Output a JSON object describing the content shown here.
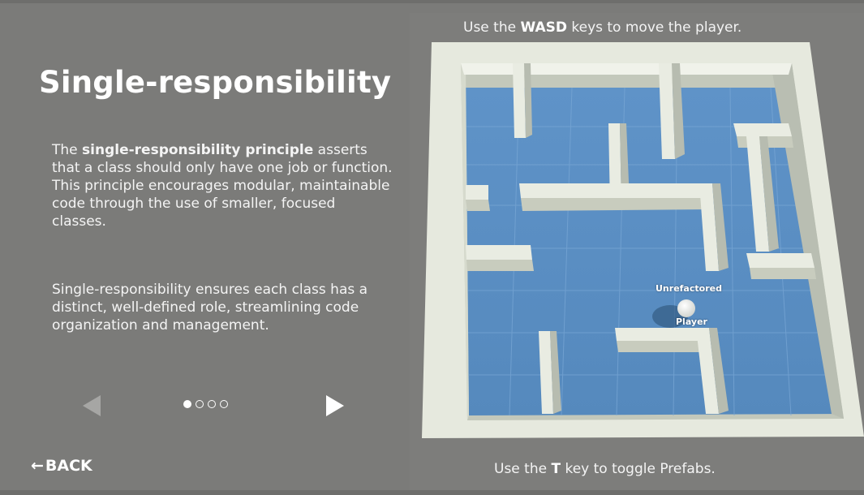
{
  "lesson": {
    "title": "Single-responsibility",
    "para1_lead": "The ",
    "para1_bold": "single-responsibility principle",
    "para1_rest": " asserts that a class should only have one job or function. This principle encourages modular, maintainable code through the use of smaller, focused classes.",
    "para2": "Single-responsibility ensures each class has a distinct, well-defined role, streamlining code organization and management."
  },
  "pager": {
    "total_pages": 4,
    "current_page": 1,
    "prev_icon": "left-triangle-icon",
    "next_icon": "right-triangle-icon"
  },
  "back_button": {
    "arrow": "←",
    "label": "BACK"
  },
  "hints": {
    "top_pre": "Use the ",
    "top_key": "WASD",
    "top_post": " keys to move the player.",
    "bottom_pre": "Use the ",
    "bottom_key": "T",
    "bottom_post": " key to toggle Prefabs."
  },
  "scene": {
    "object_label_top": "Unrefactored",
    "object_label_bottom": "Player"
  },
  "colors": {
    "background": "#7b7b79",
    "floor": "#5b8ec4",
    "wall_top": "#e6e9de",
    "wall_side": "#b9beb2",
    "text": "#ffffff"
  }
}
